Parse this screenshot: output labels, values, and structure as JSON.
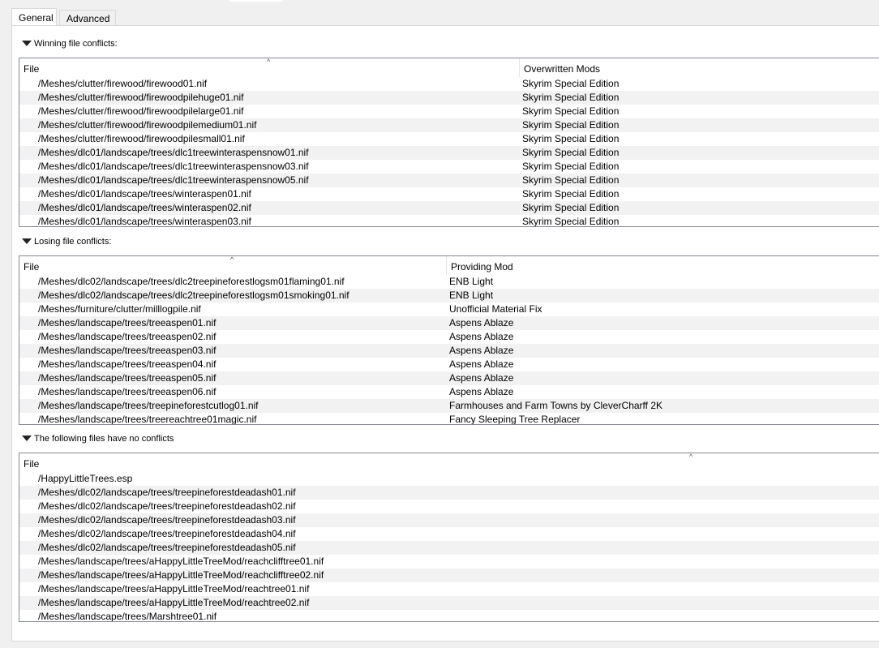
{
  "tabs": [
    {
      "label": "General",
      "active": true
    },
    {
      "label": "Advanced",
      "active": false
    }
  ],
  "winning": {
    "header": "Winning file conflicts:",
    "columns": [
      "File",
      "Overwritten Mods"
    ],
    "rows": [
      [
        "/Meshes/clutter/firewood/firewood01.nif",
        "Skyrim Special Edition"
      ],
      [
        "/Meshes/clutter/firewood/firewoodpilehuge01.nif",
        "Skyrim Special Edition"
      ],
      [
        "/Meshes/clutter/firewood/firewoodpilelarge01.nif",
        "Skyrim Special Edition"
      ],
      [
        "/Meshes/clutter/firewood/firewoodpilemedium01.nif",
        "Skyrim Special Edition"
      ],
      [
        "/Meshes/clutter/firewood/firewoodpilesmall01.nif",
        "Skyrim Special Edition"
      ],
      [
        "/Meshes/dlc01/landscape/trees/dlc1treewinteraspensnow01.nif",
        "Skyrim Special Edition"
      ],
      [
        "/Meshes/dlc01/landscape/trees/dlc1treewinteraspensnow03.nif",
        "Skyrim Special Edition"
      ],
      [
        "/Meshes/dlc01/landscape/trees/dlc1treewinteraspensnow05.nif",
        "Skyrim Special Edition"
      ],
      [
        "/Meshes/dlc01/landscape/trees/winteraspen01.nif",
        "Skyrim Special Edition"
      ],
      [
        "/Meshes/dlc01/landscape/trees/winteraspen02.nif",
        "Skyrim Special Edition"
      ],
      [
        "/Meshes/dlc01/landscape/trees/winteraspen03.nif",
        "Skyrim Special Edition"
      ]
    ]
  },
  "losing": {
    "header": "Losing file conflicts:",
    "columns": [
      "File",
      "Providing Mod"
    ],
    "rows": [
      [
        "/Meshes/dlc02/landscape/trees/dlc2treepineforestlogsm01flaming01.nif",
        "ENB Light"
      ],
      [
        "/Meshes/dlc02/landscape/trees/dlc2treepineforestlogsm01smoking01.nif",
        "ENB Light"
      ],
      [
        "/Meshes/furniture/clutter/milllogpile.nif",
        "Unofficial Material Fix"
      ],
      [
        "/Meshes/landscape/trees/treeaspen01.nif",
        "Aspens Ablaze"
      ],
      [
        "/Meshes/landscape/trees/treeaspen02.nif",
        "Aspens Ablaze"
      ],
      [
        "/Meshes/landscape/trees/treeaspen03.nif",
        "Aspens Ablaze"
      ],
      [
        "/Meshes/landscape/trees/treeaspen04.nif",
        "Aspens Ablaze"
      ],
      [
        "/Meshes/landscape/trees/treeaspen05.nif",
        "Aspens Ablaze"
      ],
      [
        "/Meshes/landscape/trees/treeaspen06.nif",
        "Aspens Ablaze"
      ],
      [
        "/Meshes/landscape/trees/treepineforestcutlog01.nif",
        "Farmhouses and Farm Towns by CleverCharff 2K"
      ],
      [
        "/Meshes/landscape/trees/treereachtree01magic.nif",
        "Fancy Sleeping Tree Replacer"
      ]
    ]
  },
  "noconflict": {
    "header": "The following files have no conflicts",
    "columns": [
      "File"
    ],
    "rows": [
      [
        "/HappyLittleTrees.esp"
      ],
      [
        "/Meshes/dlc02/landscape/trees/treepineforestdeadash01.nif"
      ],
      [
        "/Meshes/dlc02/landscape/trees/treepineforestdeadash02.nif"
      ],
      [
        "/Meshes/dlc02/landscape/trees/treepineforestdeadash03.nif"
      ],
      [
        "/Meshes/dlc02/landscape/trees/treepineforestdeadash04.nif"
      ],
      [
        "/Meshes/dlc02/landscape/trees/treepineforestdeadash05.nif"
      ],
      [
        "/Meshes/landscape/trees/aHappyLittleTreeMod/reachclifftree01.nif"
      ],
      [
        "/Meshes/landscape/trees/aHappyLittleTreeMod/reachclifftree02.nif"
      ],
      [
        "/Meshes/landscape/trees/aHappyLittleTreeMod/reachtree01.nif"
      ],
      [
        "/Meshes/landscape/trees/aHappyLittleTreeMod/reachtree02.nif"
      ],
      [
        "/Meshes/landscape/trees/Marshtree01.nif"
      ]
    ]
  },
  "icons": {
    "expanded": "triangle-down-icon",
    "sort": "sort-up-icon"
  }
}
